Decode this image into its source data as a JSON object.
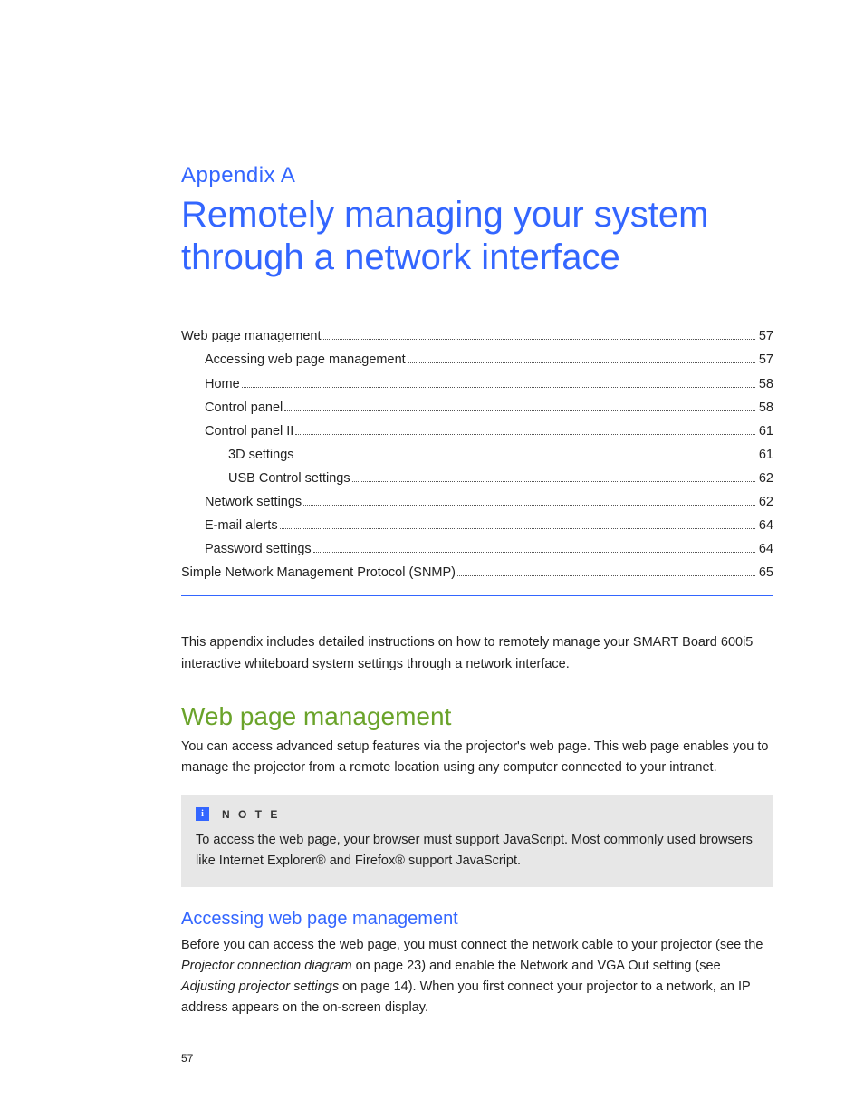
{
  "appendix": {
    "label": "Appendix  A",
    "title": "Remotely managing your system through a network interface"
  },
  "toc": [
    {
      "label": "Web page management",
      "page": "57",
      "indent": 0
    },
    {
      "label": "Accessing web page management",
      "page": "57",
      "indent": 1
    },
    {
      "label": "Home",
      "page": "58",
      "indent": 1
    },
    {
      "label": "Control panel",
      "page": "58",
      "indent": 1
    },
    {
      "label": "Control panel II",
      "page": "61",
      "indent": 1
    },
    {
      "label": "3D settings",
      "page": "61",
      "indent": 2
    },
    {
      "label": "USB Control settings",
      "page": "62",
      "indent": 2
    },
    {
      "label": "Network settings",
      "page": "62",
      "indent": 1
    },
    {
      "label": "E-mail alerts",
      "page": "64",
      "indent": 1
    },
    {
      "label": "Password settings",
      "page": "64",
      "indent": 1
    },
    {
      "label": "Simple Network Management Protocol (SNMP)",
      "page": "65",
      "indent": 0
    }
  ],
  "intro_paragraph": "This appendix includes detailed instructions on how to remotely manage your SMART Board 600i5 interactive whiteboard system settings through a network interface.",
  "section": {
    "heading": "Web page management",
    "paragraph": "You can access advanced setup features via the projector's web page. This web page enables you to manage the projector from a remote location using any computer connected to your intranet."
  },
  "note": {
    "icon_char": "i",
    "label": "N O T E",
    "text": "To access the web page, your browser must support JavaScript. Most commonly used browsers like Internet Explorer® and Firefox® support JavaScript."
  },
  "subsection": {
    "heading": "Accessing web page management",
    "p_part1": "Before you can access the web page, you must connect the network cable to your projector (see the ",
    "link1": "Projector connection diagram",
    "p_part2": " on page 23) and enable the Network and VGA Out setting (see ",
    "link2": "Adjusting projector settings",
    "p_part3": " on page 14). When you first connect your projector to a network, an IP address appears on the on-screen display."
  },
  "page_number": "57"
}
